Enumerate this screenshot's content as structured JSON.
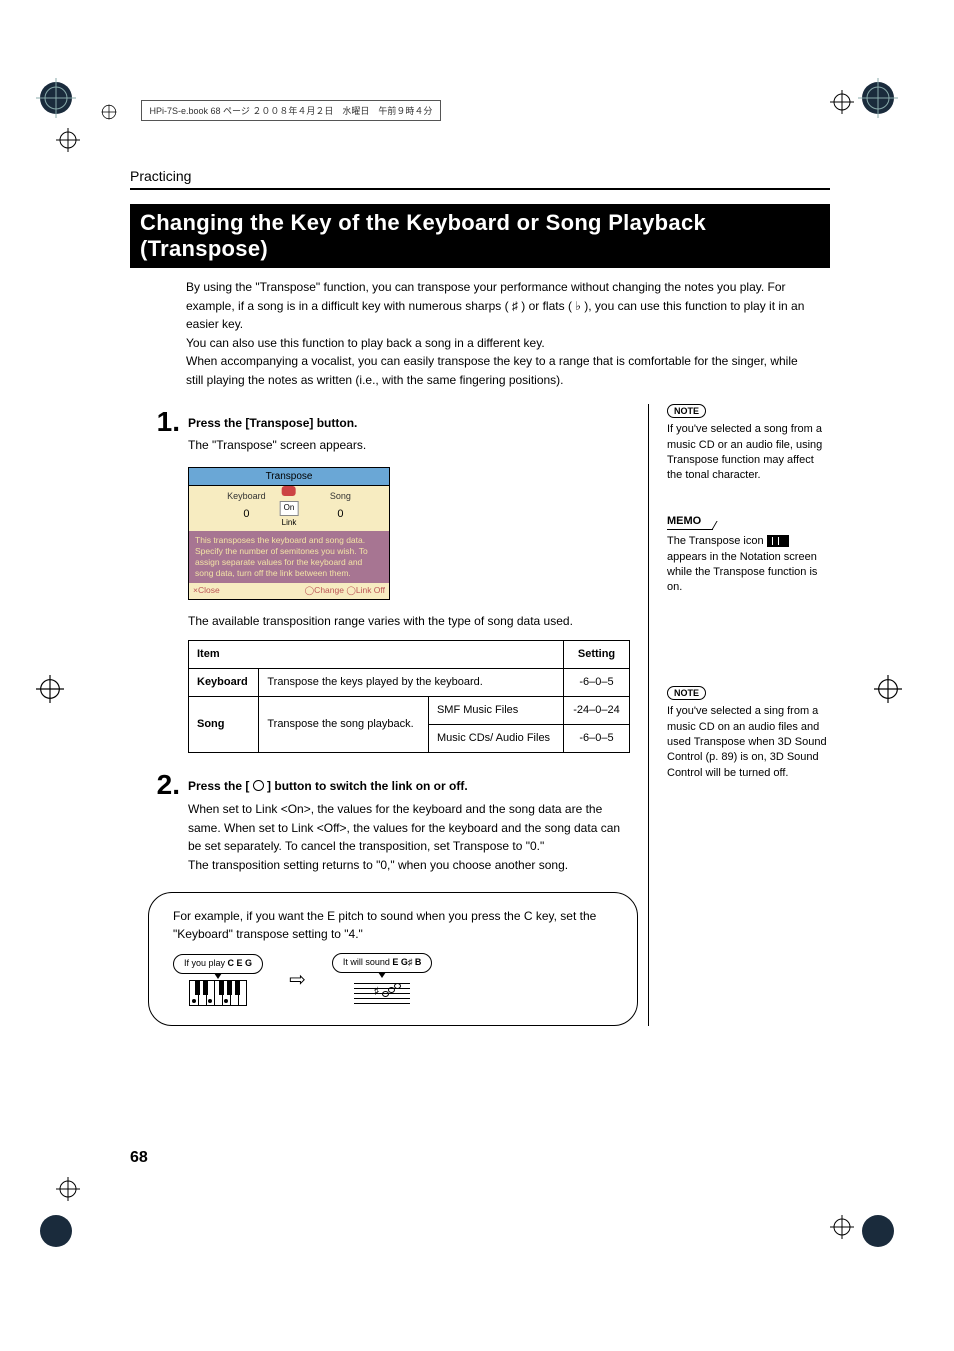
{
  "header_crop_text": "HPi-7S-e.book  68 ページ  ２００８年４月２日　水曜日　午前９時４分",
  "section_label": "Practicing",
  "title": "Changing the Key of the Keyboard or Song Playback (Transpose)",
  "intro": [
    "By using the \"Transpose\" function, you can transpose your performance without changing the notes you play. For example, if a song is in a difficult key with numerous sharps ( ♯ ) or flats ( ♭ ), you can use this function to play it in an easier key.",
    "You can also use this function to play back a song in a different key.",
    "When accompanying a vocalist, you can easily transpose the key to a range that is comfortable for the singer, while still playing the notes as written (i.e., with the same fingering positions)."
  ],
  "steps": [
    {
      "num": "1.",
      "head": "Press the [Transpose] button.",
      "body": [
        "The \"Transpose\" screen appears."
      ],
      "after_caption": "The available transposition range varies with the type of song data used."
    },
    {
      "num": "2.",
      "head_parts": [
        "Press the [ ",
        " ] button to switch the link on or off."
      ],
      "body": [
        "When set to Link <On>, the values for the keyboard and the song data are the same. When set to Link <Off>, the values for the keyboard and the song data can be set separately. To cancel the transposition, set Transpose to \"0.\"",
        "The transposition setting returns to \"0,\" when you choose another song."
      ]
    }
  ],
  "screen": {
    "title": "Transpose",
    "keyboard_label": "Keyboard",
    "keyboard_val": "0",
    "song_label": "Song",
    "song_val": "0",
    "link_on": "On",
    "link_label": "Link",
    "desc": "This transposes the keyboard and song data. Specify the number of semitones you wish. To assign separate values for the keyboard and song data, turn off the link between them.",
    "close": "×Close",
    "change": "◯Change",
    "linkoff": "◯Link Off"
  },
  "table": {
    "h_item": "Item",
    "h_setting": "Setting",
    "r1_item": "Keyboard",
    "r1_desc": "Transpose the keys played by the keyboard.",
    "r1_setting": "-6–0–5",
    "r2_item": "Song",
    "r2_desc": "Transpose the song playback.",
    "r2a_sub": "SMF Music Files",
    "r2a_setting": "-24–0–24",
    "r2b_sub": "Music CDs/ Audio Files",
    "r2b_setting": "-6–0–5"
  },
  "example": {
    "text": "For example, if you want the E pitch to sound when you press the C key, set the \"Keyboard\" transpose setting to \"4.\"",
    "play_label": "If you play",
    "play_notes": "C E G",
    "sound_label": "It will sound",
    "sound_notes": "E G♯ B"
  },
  "sidebar": [
    {
      "type": "note",
      "label": "NOTE",
      "text": "If you've selected a song from a music CD or an audio file, using Transpose function may affect the tonal character."
    },
    {
      "type": "memo",
      "label": "MEMO",
      "text_pre": "The Transpose icon ",
      "text_post": " appears in the Notation screen while the Transpose function is on."
    },
    {
      "type": "note",
      "label": "NOTE",
      "text": "If you've selected a sing from a music CD on an audio files and used Transpose when 3D Sound Control (p. 89) is on, 3D Sound Control will be turned off."
    }
  ],
  "page_number": "68"
}
